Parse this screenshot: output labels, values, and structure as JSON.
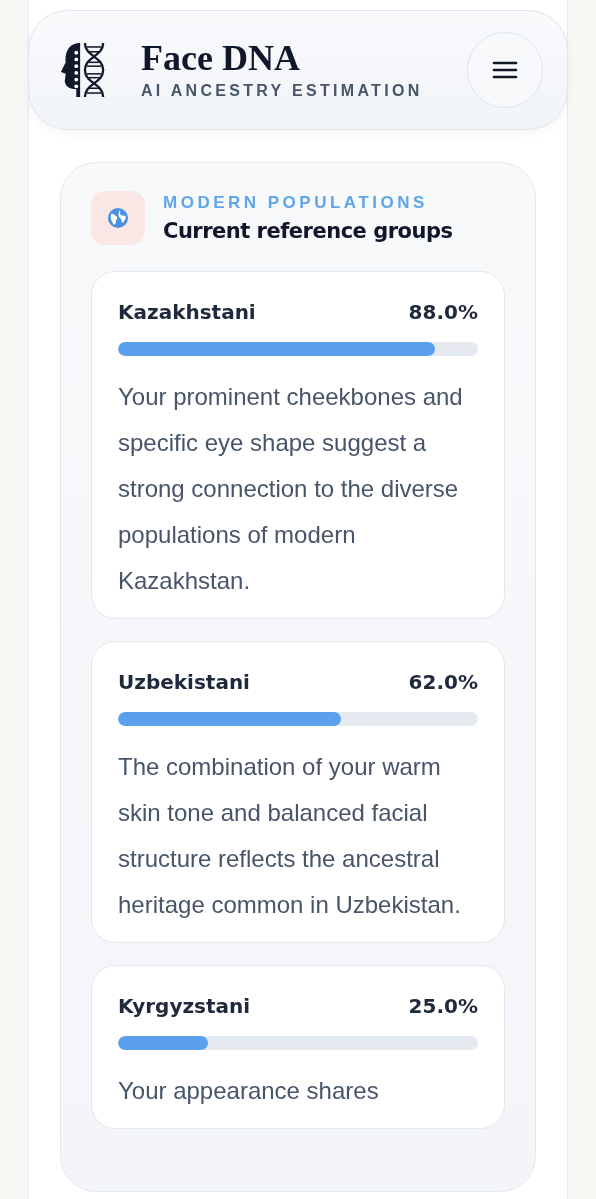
{
  "header": {
    "title": "Face DNA",
    "subtitle": "AI ANCESTRY ESTIMATION"
  },
  "section": {
    "eyebrow": "MODERN POPULATIONS",
    "title": "Current reference groups",
    "groups": [
      {
        "name": "Kazakhstani",
        "percent": "88.0%",
        "level": 0.88,
        "description": "Your prominent cheekbones and specific eye shape suggest a strong connection to the diverse populations of modern Kazakhstan."
      },
      {
        "name": "Uzbekistani",
        "percent": "62.0%",
        "level": 0.62,
        "description": "The combination of your warm skin tone and balanced facial structure reflects the ancestral heritage common in Uzbekistan."
      },
      {
        "name": "Kyrgyzstani",
        "percent": "25.0%",
        "level": 0.25,
        "description": "Your appearance shares"
      }
    ]
  }
}
